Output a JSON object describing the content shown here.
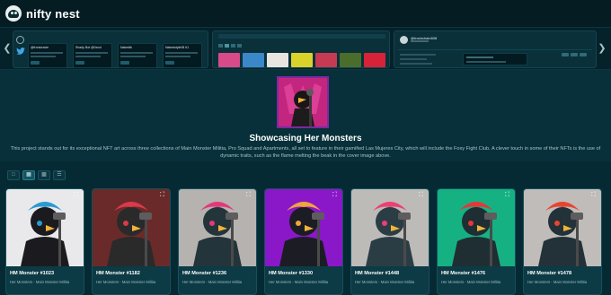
{
  "app": {
    "logo_text": "nifty nest"
  },
  "strip": {
    "panel1_cards": [
      {
        "title": "@frontoracle"
      },
      {
        "title": "Shady Bot @0xcol"
      },
      {
        "title": "Nakedtk"
      },
      {
        "title": "Nakedstyle08 #1"
      }
    ],
    "panel3_user": "@trashchain808"
  },
  "hero": {
    "title": "Showcasing Her Monsters",
    "description": "This project stands out for its exceptional NFT art across three collections of Main Monster Militia, Pro Squad and Apartments, all set to feature in their gamified Las Mujeres City, which will include the Foxy Fight Club. A clever touch in some of their NFTs is the use of dynamic traits, such as the flame melting the beak in the cover image above."
  },
  "views": [
    "grid-small",
    "grid-medium",
    "grid-large",
    "list"
  ],
  "gallery": [
    {
      "name": "HM Monster #1023",
      "collection": "Her Monsters - Main Monster Militia",
      "bg": "#e9e9ec",
      "body": "#1b1b1f",
      "accent": "#2a9ad3"
    },
    {
      "name": "HM Monster #1182",
      "collection": "Her Monsters - Main Monster Militia",
      "bg": "#6b2a2a",
      "body": "#2a2a2a",
      "accent": "#d93a4a"
    },
    {
      "name": "HM Monster #1236",
      "collection": "Her Monsters - Main Monster Militia",
      "bg": "#b6b2b0",
      "body": "#23343a",
      "accent": "#e2397a"
    },
    {
      "name": "HM Monster #1330",
      "collection": "Her Monsters - Main Monster Militia",
      "bg": "#8a18c8",
      "body": "#1c1c24",
      "accent": "#f2a53a"
    },
    {
      "name": "HM Monster #1448",
      "collection": "Her Monsters - Main Monster Militia",
      "bg": "#bdbbb8",
      "body": "#2b3d44",
      "accent": "#ec3f74"
    },
    {
      "name": "HM Monster #1476",
      "collection": "Her Monsters - Main Monster Militia",
      "bg": "#16b183",
      "body": "#1f2e33",
      "accent": "#e53737"
    },
    {
      "name": "HM Monster #1478",
      "collection": "Her Monsters - Main Monster Militia",
      "bg": "#bfbcba",
      "body": "#233238",
      "accent": "#e8452f"
    }
  ]
}
